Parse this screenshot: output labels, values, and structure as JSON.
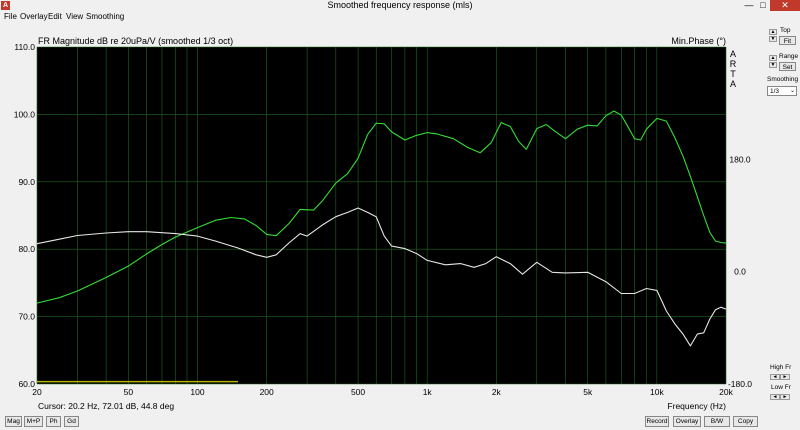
{
  "window": {
    "title": "Smoothed frequency response (mls)",
    "minimize": "—",
    "maximize": "□",
    "close": "✕",
    "app_icon": "ARTA app icon"
  },
  "menu": [
    {
      "label": "File"
    },
    {
      "label": "Overlay"
    },
    {
      "label": "Edit"
    },
    {
      "label": "View"
    },
    {
      "label": "Smoothing"
    }
  ],
  "plot": {
    "title": "FR Magnitude dB re 20uPa/V (smoothed 1/3 oct)",
    "right_title": "Min.Phase (°)",
    "brand": [
      "A",
      "R",
      "T",
      "A"
    ],
    "cursor_readout": "Cursor: 20.2 Hz, 72.01 dB, 44.8 deg",
    "xlabel": "Frequency (Hz)",
    "colors": {
      "background": "#000000",
      "magnitude": "#33dd33",
      "phase": "#e6e6e6",
      "grid": "#1f661f",
      "marker": "#b3b300"
    }
  },
  "chart_data": {
    "type": "line",
    "title": "FR Magnitude dB re 20uPa/V (smoothed 1/3 oct)",
    "xlabel": "Frequency (Hz)",
    "ylabel": "",
    "y2label": "Min.Phase (°)",
    "xscale": "log",
    "xlim": [
      20,
      20000
    ],
    "ylim": [
      60,
      110
    ],
    "y2lim": [
      -180,
      360
    ],
    "grid": true,
    "x_ticks": [
      "20",
      "50",
      "100",
      "200",
      "500",
      "1k",
      "2k",
      "5k",
      "10k",
      "20k"
    ],
    "x_tick_values": [
      20,
      50,
      100,
      200,
      500,
      1000,
      2000,
      5000,
      10000,
      20000
    ],
    "y_ticks": [
      "60.0",
      "70.0",
      "80.0",
      "90.0",
      "100.0",
      "110.0"
    ],
    "y_tick_values": [
      60,
      70,
      80,
      90,
      100,
      110
    ],
    "y2_ticks": [
      "-180.0",
      "0.0",
      "180.0"
    ],
    "y2_tick_values": [
      -180,
      0,
      180
    ],
    "series": [
      {
        "axis": "left",
        "color": "#33dd33",
        "x": [
          20,
          25,
          30,
          40,
          50,
          60,
          70,
          80,
          100,
          120,
          140,
          160,
          180,
          200,
          220,
          250,
          280,
          320,
          350,
          400,
          450,
          500,
          550,
          600,
          650,
          700,
          800,
          900,
          1000,
          1100,
          1300,
          1500,
          1700,
          1900,
          2100,
          2300,
          2500,
          2700,
          3000,
          3300,
          3600,
          4000,
          4500,
          5000,
          5500,
          6000,
          6500,
          7000,
          7500,
          8000,
          8500,
          9000,
          10000,
          11000,
          12000,
          13000,
          14000,
          15000,
          16000,
          17000,
          18000,
          19000,
          20000
        ],
        "y": [
          72.0,
          72.8,
          73.8,
          75.8,
          77.5,
          79.3,
          80.7,
          81.8,
          83.2,
          84.3,
          84.7,
          84.5,
          83.5,
          82.2,
          82.0,
          83.8,
          85.9,
          85.8,
          87.2,
          89.8,
          91.2,
          93.5,
          97.0,
          98.7,
          98.6,
          97.4,
          96.2,
          96.9,
          97.3,
          97.1,
          96.4,
          95.1,
          94.3,
          95.8,
          98.8,
          98.2,
          96.0,
          94.8,
          97.9,
          98.5,
          97.5,
          96.4,
          97.8,
          98.4,
          98.3,
          99.8,
          100.5,
          99.9,
          98.1,
          96.4,
          96.2,
          97.8,
          99.4,
          99.0,
          96.5,
          93.8,
          90.8,
          87.8,
          85.0,
          82.5,
          81.2,
          81.0,
          80.9
        ]
      },
      {
        "axis": "right",
        "color": "#e6e6e6",
        "x": [
          20,
          25,
          30,
          40,
          50,
          60,
          80,
          100,
          120,
          150,
          180,
          200,
          220,
          250,
          280,
          300,
          350,
          400,
          450,
          500,
          550,
          600,
          650,
          700,
          800,
          900,
          1000,
          1200,
          1400,
          1600,
          1800,
          2000,
          2300,
          2600,
          3000,
          3500,
          4000,
          5000,
          6000,
          7000,
          8000,
          9000,
          10000,
          11000,
          12000,
          13000,
          14000,
          15000,
          16000,
          17000,
          18000,
          19000,
          20000
        ],
        "y": [
          44.8,
          52,
          58,
          62,
          64,
          64,
          61,
          57,
          49,
          38,
          27,
          23,
          27,
          46,
          61,
          57,
          75,
          88,
          95,
          102,
          95,
          88,
          57,
          41,
          37,
          29,
          18,
          11,
          13,
          7,
          13,
          24,
          13,
          -4,
          15,
          -1,
          -2,
          -1,
          -16,
          -35,
          -35,
          -27,
          -30,
          -63,
          -84,
          -100,
          -119,
          -100,
          -98,
          -76,
          -61,
          -57,
          -60
        ]
      }
    ],
    "annotations": [
      {
        "type": "marker-line",
        "axis": "left",
        "x": [
          20,
          150
        ],
        "y": 60.2,
        "color": "#b3b300"
      }
    ]
  },
  "panel": {
    "top_label": "Top",
    "fit_label": "Fit",
    "range_label": "Range",
    "set_label": "Set",
    "smoothing_label": "Smoothing",
    "smoothing_value": "1/3",
    "highfr_label": "High Fr",
    "lowfr_label": "Low Fr",
    "spin_up": "▲",
    "spin_down": "▼",
    "spin_left": "◄",
    "spin_right": "►"
  },
  "bottom": {
    "left_buttons": [
      "Mag",
      "M+P",
      "Ph",
      "Gd"
    ],
    "right_buttons": [
      "Record",
      "Overlay",
      "B/W",
      "Copy"
    ]
  }
}
